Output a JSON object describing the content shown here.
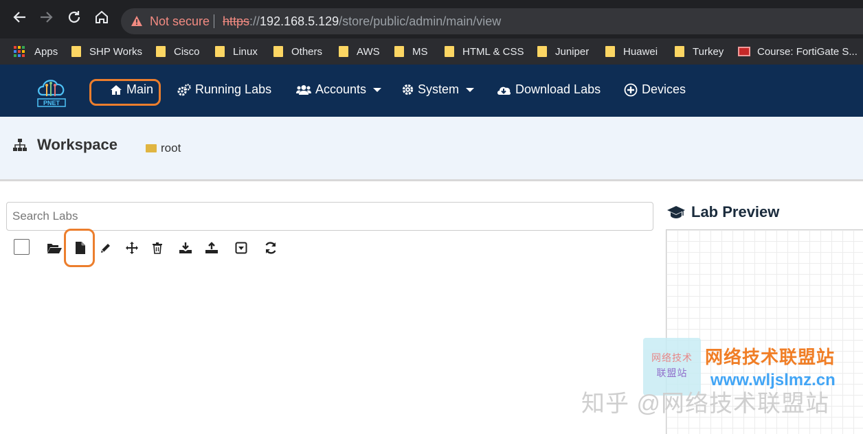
{
  "browser": {
    "security_label": "Not secure",
    "url_protocol": "https",
    "url_scheme_sep": "://",
    "url_host": "192.168.5.129",
    "url_path": "/store/public/admin/main/view"
  },
  "bookmarks": {
    "apps_label": "Apps",
    "items": [
      "SHP Works",
      "Cisco",
      "Linux",
      "Others",
      "AWS",
      "MS",
      "HTML & CSS",
      "Juniper",
      "Huawei",
      "Turkey"
    ],
    "last_item": "Course: FortiGate S..."
  },
  "navbar": {
    "logo_text": "PNET",
    "items": [
      "Main",
      "Running Labs",
      "Accounts",
      "System",
      "Download Labs",
      "Devices"
    ]
  },
  "workspace": {
    "title": "Workspace",
    "breadcrumb": "root"
  },
  "labs": {
    "search_placeholder": "Search Labs",
    "tools": [
      "folder-open-icon",
      "new-file-icon",
      "pencil-icon",
      "move-icon",
      "trash-icon",
      "download-icon",
      "upload-icon",
      "dropdown-box-icon",
      "refresh-icon"
    ]
  },
  "preview": {
    "title": "Lab Preview"
  },
  "watermark": {
    "box_line1": "网络技术",
    "box_line2": "联盟站",
    "title": "网络技术联盟站",
    "url": "www.wljslmz.cn",
    "zhihu": "知乎 @网络技术联盟站"
  },
  "colors": {
    "navbar_bg": "#0e2d54",
    "highlight": "#ec7e2d",
    "workspace_bg": "#eef4fb",
    "not_secure": "#f28b82"
  }
}
